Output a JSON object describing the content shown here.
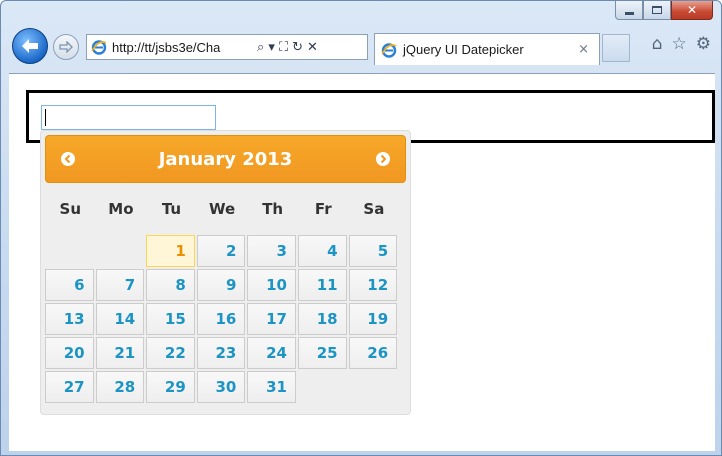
{
  "browser": {
    "address_url": "http://tt/jsbs3e/Cha",
    "tab_title": "jQuery UI Datepicker",
    "tab_close": "×",
    "tools": [
      "⌕ ▾",
      "⛶",
      "↻",
      "✕"
    ]
  },
  "window_controls": {
    "close": "✕"
  },
  "colors": {
    "header_orange": "#f6a828",
    "day_blue": "#1c94c4",
    "today_orange": "#eb8f00"
  },
  "date_input": {
    "value": "",
    "placeholder": ""
  },
  "datepicker": {
    "month_title": "January 2013",
    "weekdays": [
      "Su",
      "Mo",
      "Tu",
      "We",
      "Th",
      "Fr",
      "Sa"
    ],
    "today": 1,
    "weeks": [
      [
        "",
        "",
        "1",
        "2",
        "3",
        "4",
        "5"
      ],
      [
        "6",
        "7",
        "8",
        "9",
        "10",
        "11",
        "12"
      ],
      [
        "13",
        "14",
        "15",
        "16",
        "17",
        "18",
        "19"
      ],
      [
        "20",
        "21",
        "22",
        "23",
        "24",
        "25",
        "26"
      ],
      [
        "27",
        "28",
        "29",
        "30",
        "31",
        "",
        ""
      ]
    ]
  }
}
